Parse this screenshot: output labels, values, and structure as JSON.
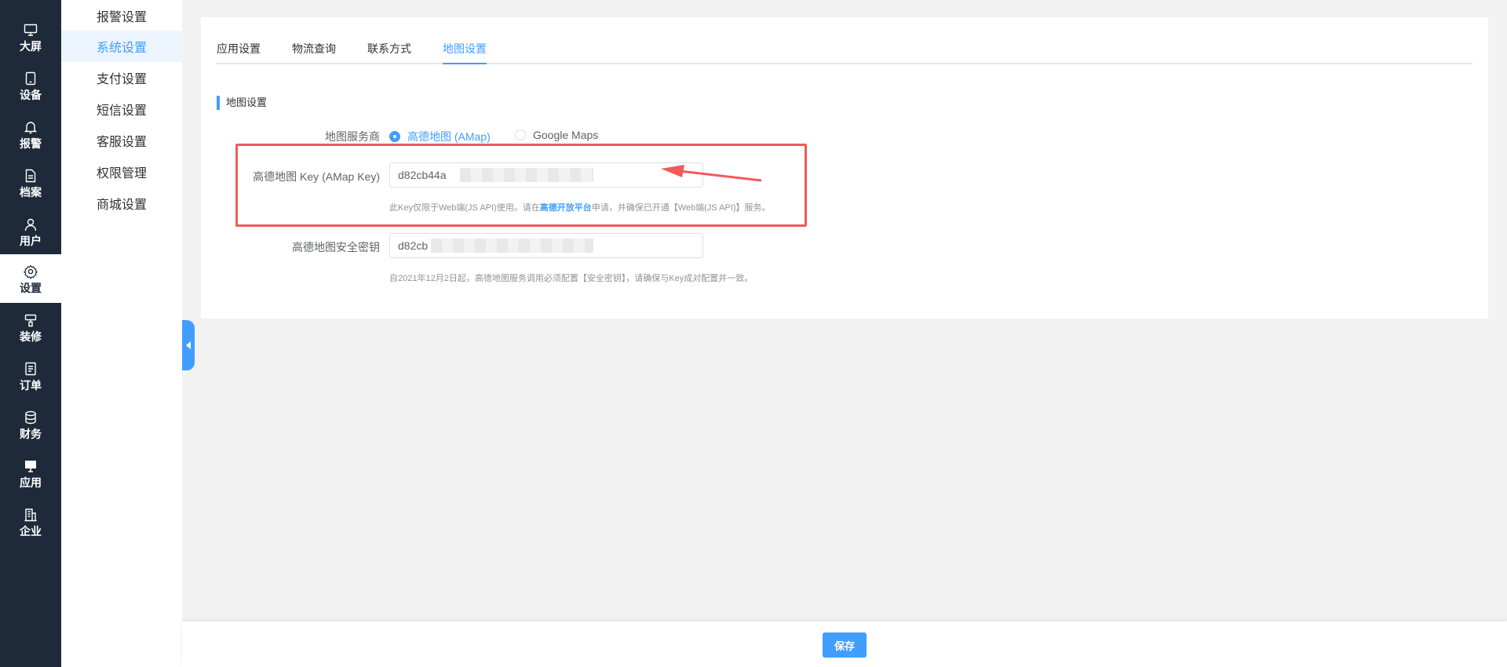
{
  "rail": {
    "items": [
      {
        "label": "大屏",
        "icon": "monitor-icon"
      },
      {
        "label": "设备",
        "icon": "tablet-icon"
      },
      {
        "label": "报警",
        "icon": "bell-icon"
      },
      {
        "label": "档案",
        "icon": "document-icon"
      },
      {
        "label": "用户",
        "icon": "user-icon"
      },
      {
        "label": "设置",
        "icon": "gear-icon"
      },
      {
        "label": "装修",
        "icon": "brush-icon"
      },
      {
        "label": "订单",
        "icon": "list-icon"
      },
      {
        "label": "财务",
        "icon": "database-icon"
      },
      {
        "label": "应用",
        "icon": "desktop-icon"
      },
      {
        "label": "企业",
        "icon": "building-icon"
      }
    ],
    "active": "设置"
  },
  "submenu": {
    "items": [
      "报警设置",
      "系统设置",
      "支付设置",
      "短信设置",
      "客服设置",
      "权限管理",
      "商城设置"
    ],
    "active": "系统设置"
  },
  "tabs": [
    "应用设置",
    "物流查询",
    "联系方式",
    "地图设置"
  ],
  "active_tab": "地图设置",
  "section_title": "地图设置",
  "form": {
    "provider_label": "地图服务商",
    "provider_options": [
      "高德地图 (AMap)",
      "Google Maps"
    ],
    "provider_selected": "高德地图 (AMap)",
    "key_label": "高德地图 Key (AMap Key)",
    "key_value": "d82cb44a",
    "key_hint_pre": "此Key仅限于Web端(JS API)使用。请在",
    "key_hint_link": "高德开放平台",
    "key_hint_post": "申请，并确保已开通【Web端(JS API)】服务。",
    "secret_label": "高德地图安全密钥",
    "secret_value": "d82cb",
    "secret_hint": "自2021年12月2日起，高德地图服务调用必须配置【安全密钥】，请确保与Key成对配置并一致。"
  },
  "save_label": "保存",
  "colors": {
    "rail_bg": "#1e2a3a",
    "accent": "#409eff",
    "highlight": "#f15a5a"
  }
}
